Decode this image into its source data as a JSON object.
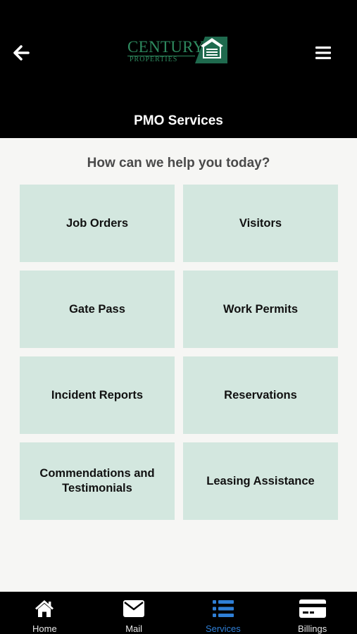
{
  "header": {
    "logo_text": "CENTURY",
    "logo_subtext": "PROPERTIES",
    "title": "PMO Services",
    "back_icon": "arrow-left-icon",
    "menu_icon": "hamburger-menu-icon"
  },
  "main": {
    "prompt": "How can we help you today?",
    "services": [
      {
        "label": "Job Orders"
      },
      {
        "label": "Visitors"
      },
      {
        "label": "Gate Pass"
      },
      {
        "label": "Work Permits"
      },
      {
        "label": "Incident Reports"
      },
      {
        "label": "Reservations"
      },
      {
        "label": "Commendations and Testimonials"
      },
      {
        "label": "Leasing Assistance"
      }
    ]
  },
  "tabbar": {
    "tabs": [
      {
        "label": "Home",
        "icon": "home-icon"
      },
      {
        "label": "Mail",
        "icon": "mail-icon"
      },
      {
        "label": "Services",
        "icon": "list-icon",
        "active": true
      },
      {
        "label": "Billings",
        "icon": "credit-card-icon"
      }
    ]
  },
  "colors": {
    "header_bg": "#000000",
    "tile_bg": "#d3e7df",
    "brand_green": "#2e8a5f",
    "active_tab": "#2f7fd6"
  }
}
